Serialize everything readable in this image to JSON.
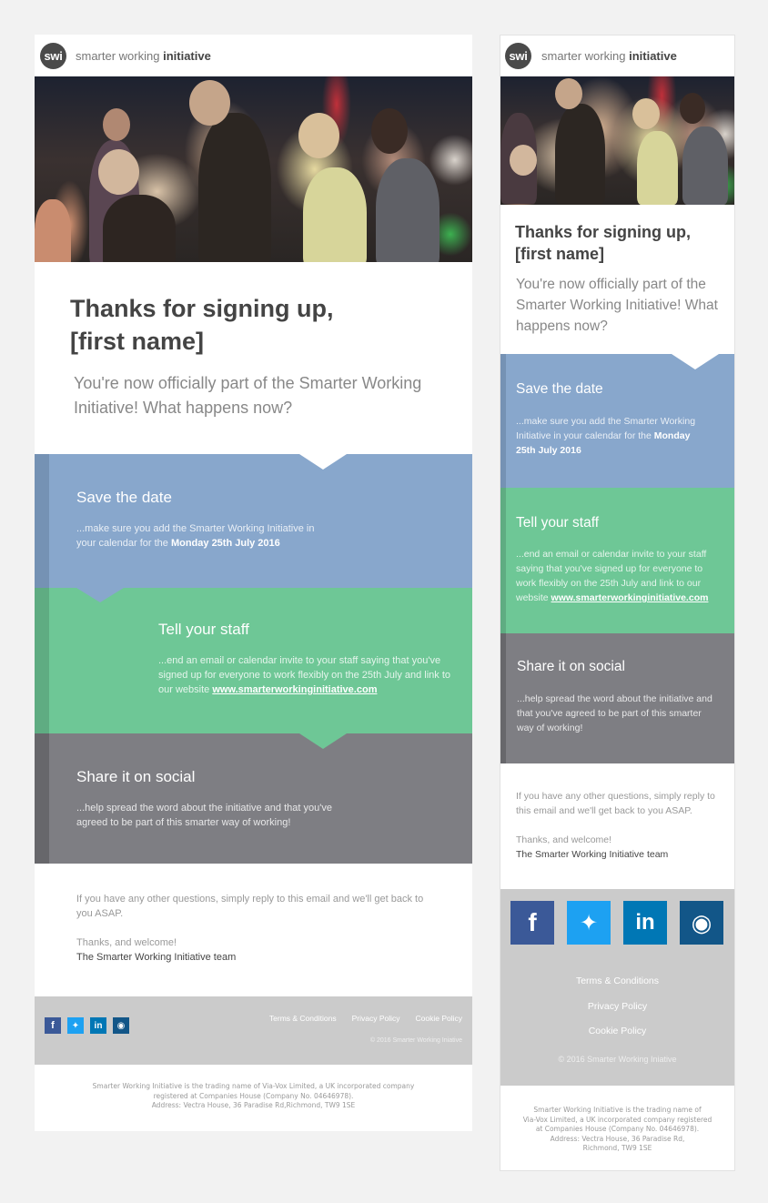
{
  "brand": {
    "logo_text": "swi",
    "name_light": "smarter working",
    "name_bold": "initiative"
  },
  "hero": {
    "image_alt": "Audience standing and applauding at an event"
  },
  "intro": {
    "heading_line1": "Thanks for signing up,",
    "heading_line2": "[first name]",
    "lead": "You're now officially part of the Smarter Working Initiative! What happens now?"
  },
  "steps": [
    {
      "title": "Save the date",
      "text": "...make sure you add the Smarter Working Initiative in your calendar for the",
      "emphasis": "Monday 25th July 2016",
      "color": "#88a7cc"
    },
    {
      "title": "Tell your staff",
      "text": "...end an email or calendar invite to your staff saying that you've signed up for everyone to work flexibly on the 25th July and link to our website",
      "link": "www.smarterworkinginitiative.com",
      "color": "#6ec796"
    },
    {
      "title": "Share it on social",
      "text": "...help spread the word about the initiative and that you've agreed to be part of this smarter way of working!",
      "color": "#7e7e83"
    }
  ],
  "signoff": {
    "question": "If you have any other questions, simply reply to this email and we'll get back to you ASAP.",
    "thanks": "Thanks, and welcome!",
    "team": "The Smarter Working Initiative team"
  },
  "social": [
    {
      "name": "facebook",
      "glyph": "f",
      "color": "#3b5998"
    },
    {
      "name": "twitter",
      "glyph": "t",
      "color": "#1da1f2"
    },
    {
      "name": "linkedin",
      "glyph": "in",
      "color": "#0077b5"
    },
    {
      "name": "instagram",
      "glyph": "ig",
      "color": "#125688"
    }
  ],
  "footer": {
    "links": [
      "Terms & Conditions",
      "Privacy Policy",
      "Cookie Policy"
    ],
    "copyright": "© 2016 Smarter Working Iniative"
  },
  "legal": {
    "line1": "Smarter Working Initiative is the trading name of Via-Vox Limited, a UK incorporated company",
    "line2": "registered at Companies House (Company No. 04646978).",
    "line3": "Address: Vectra House, 36 Paradise Rd,Richmond, TW9 1SE",
    "mobile_line1": "Smarter Working Initiative is the trading name of",
    "mobile_line2": "Via-Vox Limited, a UK incorporated company registered",
    "mobile_line3": "at Companies House (Company No. 04646978).",
    "mobile_line4": "Address: Vectra House, 36 Paradise Rd,",
    "mobile_line5": "Richmond, TW9 1SE"
  }
}
